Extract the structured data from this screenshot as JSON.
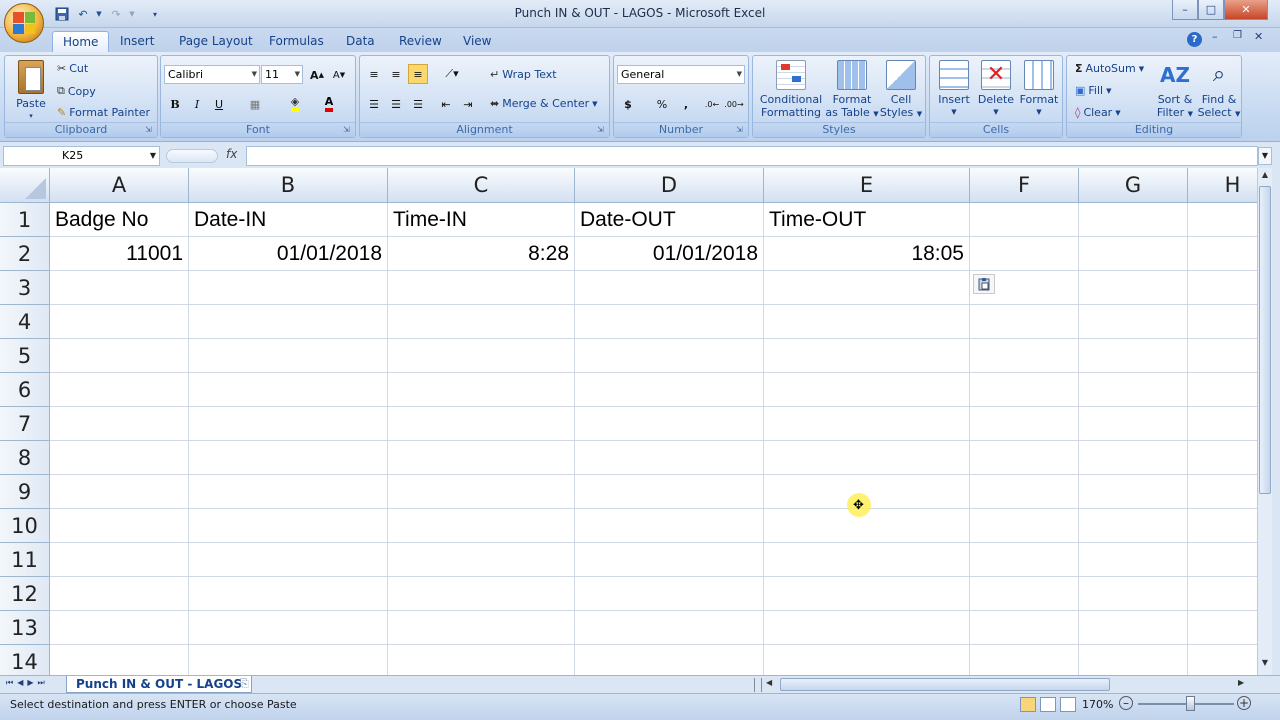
{
  "window": {
    "title": "Punch IN & OUT - LAGOS - Microsoft Excel",
    "minimize": "–",
    "maximize": "□",
    "close": "✕"
  },
  "tabs": [
    {
      "label": "Home",
      "active": true
    },
    {
      "label": "Insert"
    },
    {
      "label": "Page Layout"
    },
    {
      "label": "Formulas"
    },
    {
      "label": "Data"
    },
    {
      "label": "Review"
    },
    {
      "label": "View"
    }
  ],
  "ribbon": {
    "clipboard": {
      "label": "Clipboard",
      "paste": "Paste",
      "cut": "Cut",
      "copy": "Copy",
      "format_painter": "Format Painter"
    },
    "font": {
      "label": "Font",
      "family": "Calibri",
      "size": "11",
      "bold": "B",
      "italic": "I",
      "underline": "U"
    },
    "alignment": {
      "label": "Alignment",
      "wrap_text": "Wrap Text",
      "merge_center": "Merge & Center"
    },
    "number": {
      "label": "Number",
      "format": "General",
      "currency": "$",
      "percent": "%",
      "comma": ","
    },
    "styles": {
      "label": "Styles",
      "conditional": [
        "Conditional",
        "Formatting"
      ],
      "format_table": [
        "Format",
        "as Table"
      ],
      "cell_styles": [
        "Cell",
        "Styles"
      ]
    },
    "cells": {
      "label": "Cells",
      "insert": "Insert",
      "delete": "Delete",
      "format": "Format"
    },
    "editing": {
      "label": "Editing",
      "autosum": "AutoSum",
      "fill": "Fill",
      "clear": "Clear",
      "sort_filter": [
        "Sort &",
        "Filter"
      ],
      "find_select": [
        "Find &",
        "Select"
      ]
    }
  },
  "formula_bar": {
    "name_box": "K25",
    "fx": "fx",
    "value": ""
  },
  "columns": [
    "A",
    "B",
    "C",
    "D",
    "E",
    "F",
    "G",
    "H"
  ],
  "rows": [
    "1",
    "2",
    "3",
    "4",
    "5",
    "6",
    "7",
    "8",
    "9",
    "10",
    "11",
    "12",
    "13",
    "14"
  ],
  "cells": {
    "A1": "Badge No",
    "B1": "Date-IN",
    "C1": "Time-IN",
    "D1": "Date-OUT",
    "E1": "Time-OUT",
    "A2": "11001",
    "B2": "01/01/2018",
    "C2": "8:28",
    "D2": "01/01/2018",
    "E2": "18:05"
  },
  "sheet_tab": "Punch IN & OUT - LAGOS",
  "status": {
    "message": "Select destination and press ENTER or choose Paste",
    "zoom": "170%"
  },
  "colors": {
    "accent": "#15428b",
    "ribbon": "#c6d9f1",
    "grid_line": "#d0d7e5"
  }
}
